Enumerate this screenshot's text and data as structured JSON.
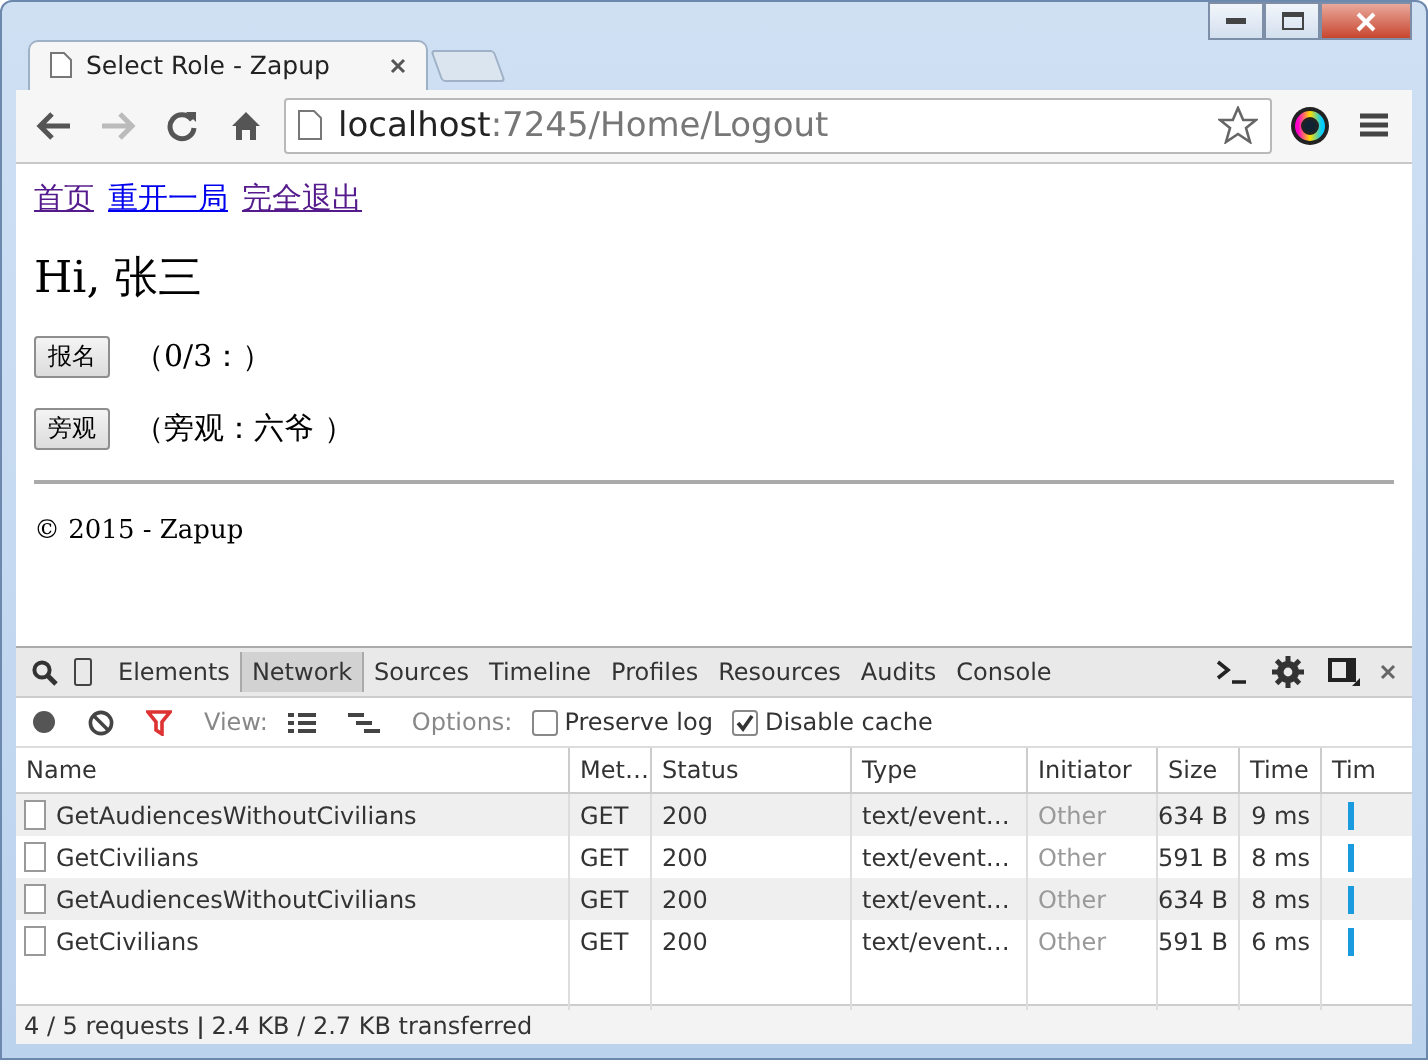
{
  "browser": {
    "tabs": [
      {
        "title": "Select Role - Zapup",
        "selected": true
      }
    ],
    "address": {
      "host": "localhost",
      "path": ":7245/Home/Logout"
    }
  },
  "page": {
    "links": [
      {
        "label": "首页",
        "visited": true
      },
      {
        "label": "重开一局",
        "visited": false
      },
      {
        "label": "完全退出",
        "visited": true
      }
    ],
    "greeting": "Hi, 张三",
    "actions": [
      {
        "button": "报名",
        "note": "（0/3：）"
      },
      {
        "button": "旁观",
        "note": "（旁观：六爷 ）"
      }
    ],
    "footer": "© 2015 - Zapup"
  },
  "devtools": {
    "tabs": [
      {
        "label": "Elements",
        "selected": false
      },
      {
        "label": "Network",
        "selected": true
      },
      {
        "label": "Sources",
        "selected": false
      },
      {
        "label": "Timeline",
        "selected": false
      },
      {
        "label": "Profiles",
        "selected": false
      },
      {
        "label": "Resources",
        "selected": false
      },
      {
        "label": "Audits",
        "selected": false
      },
      {
        "label": "Console",
        "selected": false
      }
    ],
    "toolbar": {
      "view_label": "View:",
      "options_label": "Options:",
      "checkboxes": [
        {
          "label": "Preserve log",
          "checked": false
        },
        {
          "label": "Disable cache",
          "checked": true
        }
      ]
    },
    "table": {
      "columns": [
        "Name",
        "Met…",
        "Status",
        "Type",
        "Initiator",
        "Size",
        "Time",
        "Tim"
      ],
      "rows": [
        [
          "GetAudiencesWithoutCivilians",
          "GET",
          "200",
          "text/event…",
          "Other",
          "634 B",
          "9 ms"
        ],
        [
          "GetCivilians",
          "GET",
          "200",
          "text/event…",
          "Other",
          "591 B",
          "8 ms"
        ],
        [
          "GetAudiencesWithoutCivilians",
          "GET",
          "200",
          "text/event…",
          "Other",
          "634 B",
          "8 ms"
        ],
        [
          "GetCivilians",
          "GET",
          "200",
          "text/event…",
          "Other",
          "591 B",
          "6 ms"
        ]
      ]
    },
    "status_bar": "4 / 5 requests  ǀ  2.4 KB / 2.7 KB transferred"
  }
}
